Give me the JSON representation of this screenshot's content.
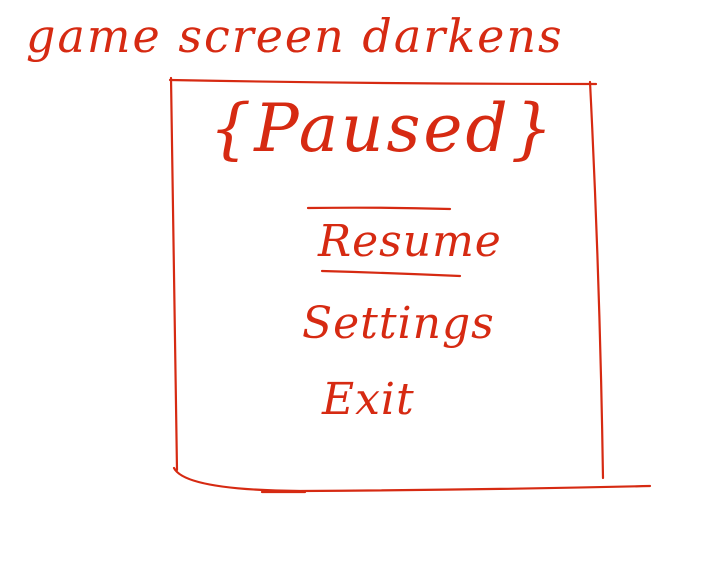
{
  "sketch": {
    "ink_color": "#d62a12",
    "annotation": "game screen darkens"
  },
  "pause_menu": {
    "title": "{Paused}",
    "items": [
      {
        "label": "Resume",
        "selected": true
      },
      {
        "label": "Settings",
        "selected": false
      },
      {
        "label": "Exit",
        "selected": false
      }
    ]
  }
}
